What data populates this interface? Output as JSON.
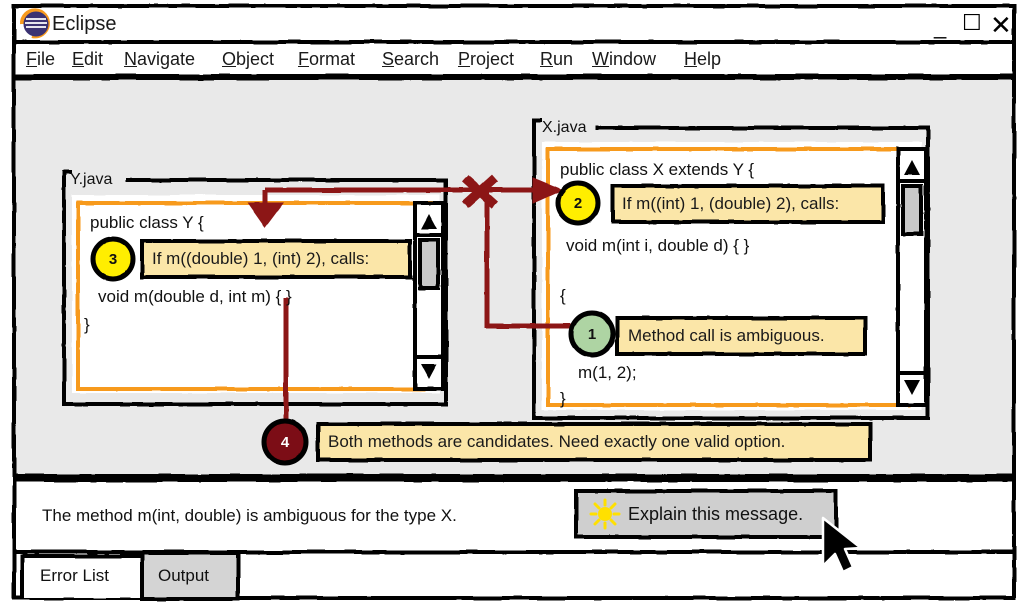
{
  "window": {
    "title": "Eclipse",
    "app_icon": "eclipse-logo-icon",
    "controls": {
      "minimize": "_",
      "maximize": "☐",
      "close": "✕"
    }
  },
  "menubar": {
    "items": [
      {
        "label": "File",
        "mnemonic": "F"
      },
      {
        "label": "Edit",
        "mnemonic": "E"
      },
      {
        "label": "Navigate",
        "mnemonic": "N"
      },
      {
        "label": "Object",
        "mnemonic": "O"
      },
      {
        "label": "Format",
        "mnemonic": "F"
      },
      {
        "label": "Search",
        "mnemonic": "S"
      },
      {
        "label": "Project",
        "mnemonic": "P"
      },
      {
        "label": "Run",
        "mnemonic": "R"
      },
      {
        "label": "Window",
        "mnemonic": "W"
      },
      {
        "label": "Help",
        "mnemonic": "H"
      }
    ]
  },
  "editors": [
    {
      "id": "y-java",
      "title": "Y.java",
      "code_lines": [
        "public class Y {",
        "void m(double d, int m) { }",
        "}"
      ],
      "scrollbar": {
        "up": "▲",
        "down": "▼"
      }
    },
    {
      "id": "x-java",
      "title": "X.java",
      "code_lines": [
        "public class X extends Y {",
        "void m(int i, double d) { }",
        "{",
        "m(1, 2);",
        "}"
      ],
      "scrollbar": {
        "up": "▲",
        "down": "▼"
      }
    }
  ],
  "annotations": [
    {
      "number": "1",
      "text": "Method call is ambiguous.",
      "circle_color": "#aed4a3",
      "text_color": "#111111"
    },
    {
      "number": "2",
      "text": "If m((int) 1, (double) 2), calls:",
      "circle_color": "#ffee00",
      "text_color": "#111111"
    },
    {
      "number": "3",
      "text": "If m((double) 1, (int) 2), calls:",
      "circle_color": "#ffee00",
      "text_color": "#111111"
    },
    {
      "number": "4",
      "text": "Both methods are candidates. Need exactly one valid option.",
      "circle_color": "#7c0a12",
      "text_color": "#ffffff"
    }
  ],
  "status_bar": {
    "message": "The method m(int, double) is ambiguous for the type X.",
    "explain_button": {
      "label": "Explain this message.",
      "icon": "lightbulb-sun-icon",
      "icon_color": "#ffe000"
    }
  },
  "bottom_tabs": {
    "items": [
      {
        "label": "Error List",
        "active": false
      },
      {
        "label": "Output",
        "active": true
      }
    ]
  },
  "cursor": {
    "type": "arrow-pointer"
  },
  "colors": {
    "annotation_fill": "#fbe6a8",
    "editor_border": "#f79a1e",
    "arrow_red": "#8c1515",
    "chrome_bg": "#e9e9e9",
    "panel_white": "#ffffff"
  }
}
